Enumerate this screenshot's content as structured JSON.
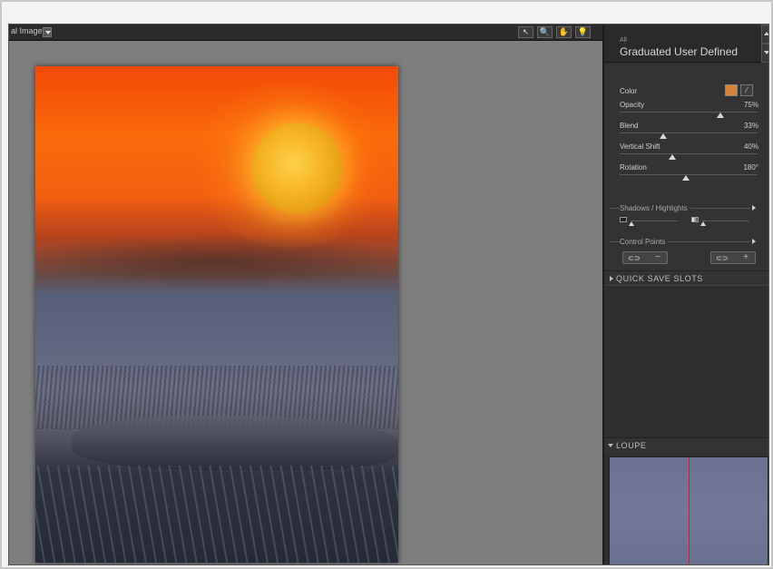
{
  "toolbar": {
    "view_label": "al Image",
    "tools": [
      {
        "icon": "arrow-pointer-icon",
        "glyph": "↖"
      },
      {
        "icon": "zoom-icon",
        "glyph": "🔍"
      },
      {
        "icon": "hand-icon",
        "glyph": "✋"
      },
      {
        "icon": "bulb-icon",
        "glyph": "💡"
      }
    ]
  },
  "preset": {
    "category": "All",
    "name": "Graduated User Defined"
  },
  "controls": {
    "color_label": "Color",
    "color_value": "#d7843a",
    "sliders": [
      {
        "label": "Opacity",
        "value": "75%",
        "level": 0.75
      },
      {
        "label": "Blend",
        "value": "33%",
        "level": 0.33
      },
      {
        "label": "Vertical Shift",
        "value": "40%",
        "level": 0.4
      },
      {
        "label": "Rotation",
        "value": "180°",
        "level": 0.5
      }
    ],
    "shadows_highlights_label": "Shadows / Highlights",
    "control_points_label": "Control Points",
    "control_points_buttons": [
      {
        "symbol": "−"
      },
      {
        "symbol": "+"
      }
    ]
  },
  "quick_save": {
    "label": "QUICK SAVE SLOTS"
  },
  "loupe": {
    "label": "LOUPE"
  }
}
